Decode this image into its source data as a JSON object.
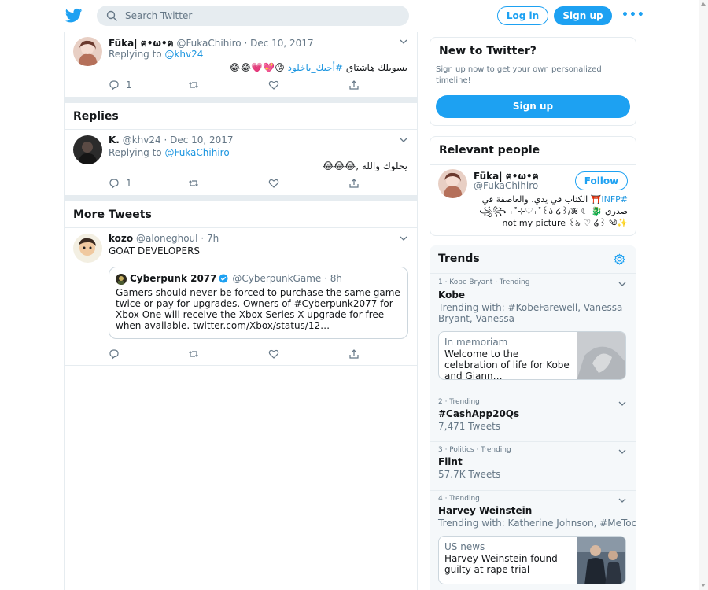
{
  "colors": {
    "accent": "#1da1f2",
    "link": "#1b95e0",
    "text": "#14171a",
    "muted": "#657786",
    "border": "#e6ecf0",
    "heart": "#e0245e"
  },
  "topbar": {
    "search_placeholder": "Search Twitter",
    "login_label": "Log in",
    "signup_label": "Sign up",
    "more_label": "•••"
  },
  "main": {
    "tweet1": {
      "name": "Fūka| ",
      "cjk": "ฅ•ω•ฅ",
      "handle": "@FukaChihiro",
      "date": "· Dec 10, 2017",
      "replying_prefix": "Replying to ",
      "replying_to": "@khv24",
      "text_plain": "بسويلك هاشتاق ",
      "text_hashtag": "#أحبك_ياخلود",
      "text_emoji": " 😘💖💗😂😂",
      "reply_count": "1"
    },
    "replies_heading": "Replies",
    "tweet2": {
      "name": "K.",
      "handle": "@khv24",
      "date": "· Dec 10, 2017",
      "replying_prefix": "Replying to ",
      "replying_to": "@FukaChihiro",
      "text": "يحلوك والله ,😂😂😂",
      "reply_count": "1"
    },
    "more_heading": "More Tweets",
    "tweet3": {
      "name": "kozo",
      "handle": "@aloneghoul",
      "date": "· 7h",
      "text": "GOAT DEVELOPERS",
      "quote": {
        "name": "Cyberpunk 2077",
        "handle": "@CyberpunkGame",
        "date": "· 8h",
        "text": "Gamers should never be forced to purchase the same game twice or pay for upgrades. Owners of #Cyberpunk2077 for Xbox One will receive the Xbox Series X upgrade for free when available. twitter.com/Xbox/status/12…"
      }
    }
  },
  "sidebar": {
    "new": {
      "title": "New to Twitter?",
      "desc": "Sign up now to get your own personalized timeline!",
      "signup_label": "Sign up"
    },
    "relevant": {
      "title": "Relevant people",
      "name": "Fūka| ",
      "cjk": "ฅ•ω•ฅ",
      "handle": "@FukaChihiro",
      "follow_label": "Follow",
      "bio_hashtag": "#INFP",
      "bio_line1": "⛩️ الكتاب في يدي، والعاصفة في",
      "bio_line2": "صدري 🐉 ☾ ꧁꧂ ₊˚⊹♡₊˚꒰ა ໒꒱/ꕤ",
      "bio_line3": "✨not my picture ꒰ঌ ♡ ໒꒱ ༄"
    },
    "trends": {
      "title": "Trends",
      "items": [
        {
          "meta": "1 · Kobe Bryant · Trending",
          "name": "Kobe",
          "sub": "Trending with: #KobeFarewell, Vanessa Bryant, Vanessa",
          "card": {
            "category": "In memoriam",
            "title": "Welcome to the celebration of life for Kobe and Giann…"
          }
        },
        {
          "meta": "2 · Trending",
          "name": "#CashApp20Qs",
          "sub": "7,471 Tweets"
        },
        {
          "meta": "3 · Politics · Trending",
          "name": "Flint",
          "sub": "57.7K Tweets"
        },
        {
          "meta": "4 · Trending",
          "name": "Harvey Weinstein",
          "sub": "Trending with: Katherine Johnson, #MeToo",
          "card": {
            "category": "US news",
            "title": "Harvey Weinstein found guilty at rape trial"
          }
        }
      ]
    }
  }
}
